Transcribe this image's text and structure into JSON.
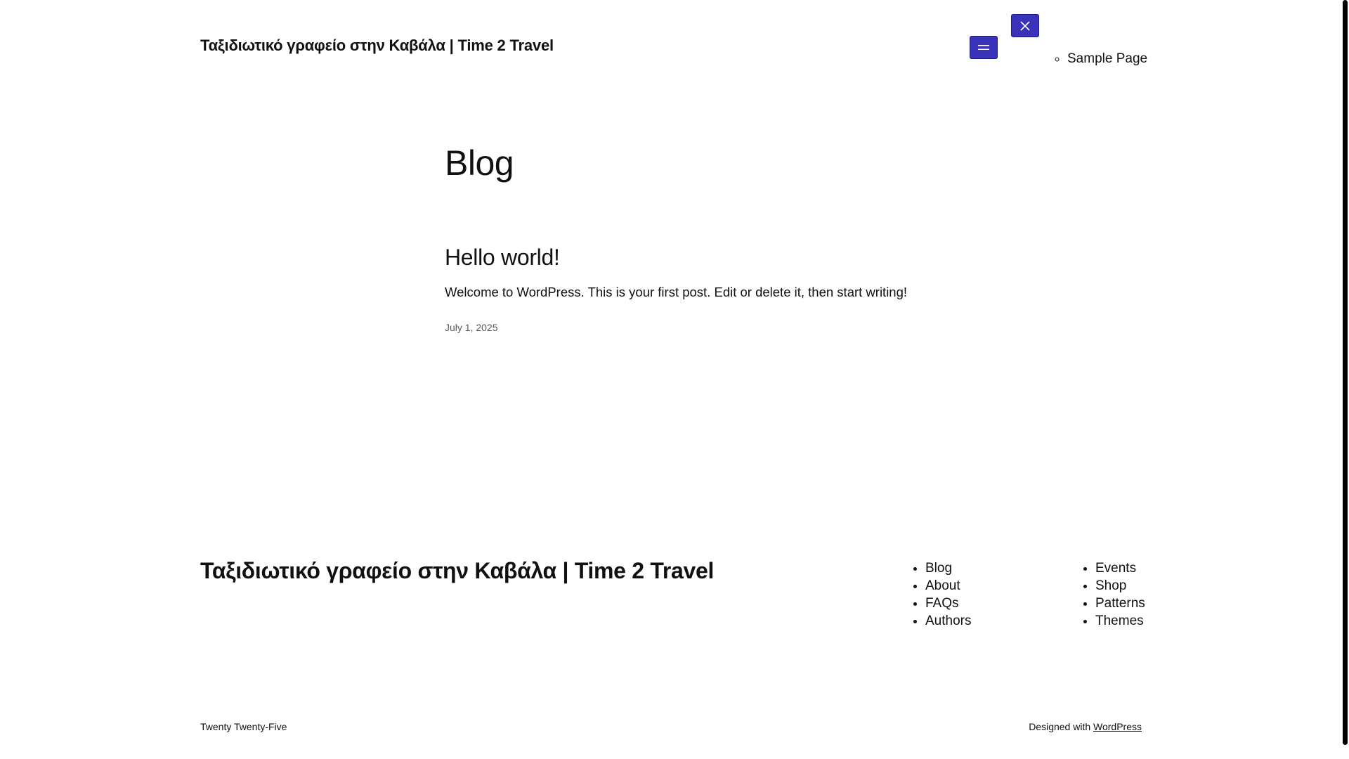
{
  "header": {
    "site_title": "Ταξιδιωτικό γραφείο στην Καβάλα | Time 2 Travel",
    "open_menu_icon": "hamburger-icon",
    "close_menu_icon": "close-icon",
    "nav_items": [
      {
        "label": "Sample Page"
      }
    ]
  },
  "main": {
    "heading": "Blog",
    "posts": [
      {
        "title": "Hello world!",
        "excerpt": "Welcome to WordPress. This is your first post. Edit or delete it, then start writing!",
        "date": "July 1, 2025"
      }
    ]
  },
  "footer": {
    "site_title": "Ταξιδιωτικό γραφείο στην Καβάλα | Time 2 Travel",
    "nav_col_1": [
      {
        "label": "Blog"
      },
      {
        "label": "About"
      },
      {
        "label": "FAQs"
      },
      {
        "label": "Authors"
      }
    ],
    "nav_col_2": [
      {
        "label": "Events"
      },
      {
        "label": "Shop"
      },
      {
        "label": "Patterns"
      },
      {
        "label": "Themes"
      }
    ],
    "theme_credit": "Twenty Twenty-Five",
    "designed_with_prefix": "Designed with",
    "designed_with_link": "WordPress"
  },
  "colors": {
    "accent_button": "#3a32b8",
    "text": "#111111",
    "date_text": "#5a5a5a"
  }
}
